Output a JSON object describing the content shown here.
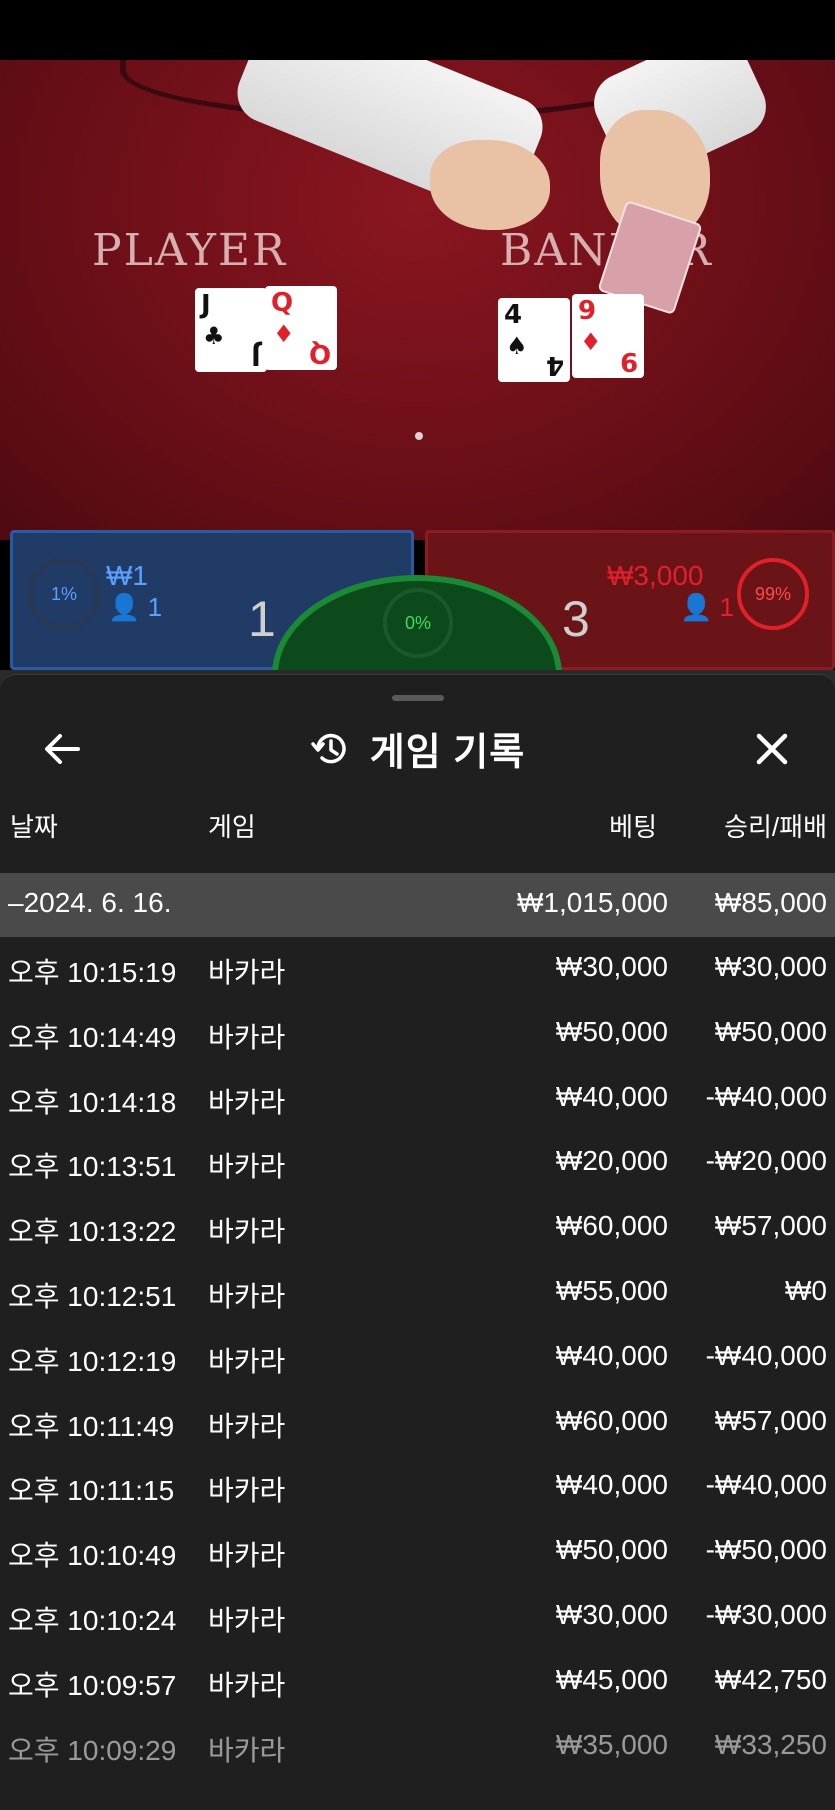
{
  "video": {
    "player_label": "PLAYER",
    "banker_label": "BANKER",
    "player_cards": [
      {
        "rank": "J",
        "suit": "♣",
        "color": "black"
      },
      {
        "rank": "Q",
        "suit": "♦",
        "color": "red"
      }
    ],
    "banker_cards": [
      {
        "rank": "4",
        "suit": "♠",
        "color": "black"
      },
      {
        "rank": "9",
        "suit": "♦",
        "color": "red"
      }
    ]
  },
  "bets": {
    "player": {
      "percent": "1%",
      "amount": "₩1",
      "count": "1",
      "score": "1"
    },
    "tie": {
      "percent": "0%"
    },
    "banker": {
      "percent": "99%",
      "amount": "₩3,000",
      "count": "1",
      "score": "3"
    }
  },
  "sheet": {
    "title": "게임 기록",
    "icons": {
      "back": "arrow-left-icon",
      "history": "history-icon",
      "close": "close-icon"
    },
    "columns": {
      "date": "날짜",
      "game": "게임",
      "bet": "베팅",
      "result": "승리/패배"
    },
    "group": {
      "date": "–2024. 6. 16.",
      "bet": "₩1,015,000",
      "result": "₩85,000"
    },
    "rows": [
      {
        "time": "오후 10:15:19",
        "game": "바카라",
        "bet": "₩30,000",
        "result": "₩30,000"
      },
      {
        "time": "오후 10:14:49",
        "game": "바카라",
        "bet": "₩50,000",
        "result": "₩50,000"
      },
      {
        "time": "오후 10:14:18",
        "game": "바카라",
        "bet": "₩40,000",
        "result": "-₩40,000"
      },
      {
        "time": "오후 10:13:51",
        "game": "바카라",
        "bet": "₩20,000",
        "result": "-₩20,000"
      },
      {
        "time": "오후 10:13:22",
        "game": "바카라",
        "bet": "₩60,000",
        "result": "₩57,000"
      },
      {
        "time": "오후 10:12:51",
        "game": "바카라",
        "bet": "₩55,000",
        "result": "₩0"
      },
      {
        "time": "오후 10:12:19",
        "game": "바카라",
        "bet": "₩40,000",
        "result": "-₩40,000"
      },
      {
        "time": "오후 10:11:49",
        "game": "바카라",
        "bet": "₩60,000",
        "result": "₩57,000"
      },
      {
        "time": "오후 10:11:15",
        "game": "바카라",
        "bet": "₩40,000",
        "result": "-₩40,000"
      },
      {
        "time": "오후 10:10:49",
        "game": "바카라",
        "bet": "₩50,000",
        "result": "-₩50,000"
      },
      {
        "time": "오후 10:10:24",
        "game": "바카라",
        "bet": "₩30,000",
        "result": "-₩30,000"
      },
      {
        "time": "오후 10:09:57",
        "game": "바카라",
        "bet": "₩45,000",
        "result": "₩42,750"
      },
      {
        "time": "오후 10:09:29",
        "game": "바카라",
        "bet": "₩35,000",
        "result": "₩33,250"
      }
    ]
  }
}
